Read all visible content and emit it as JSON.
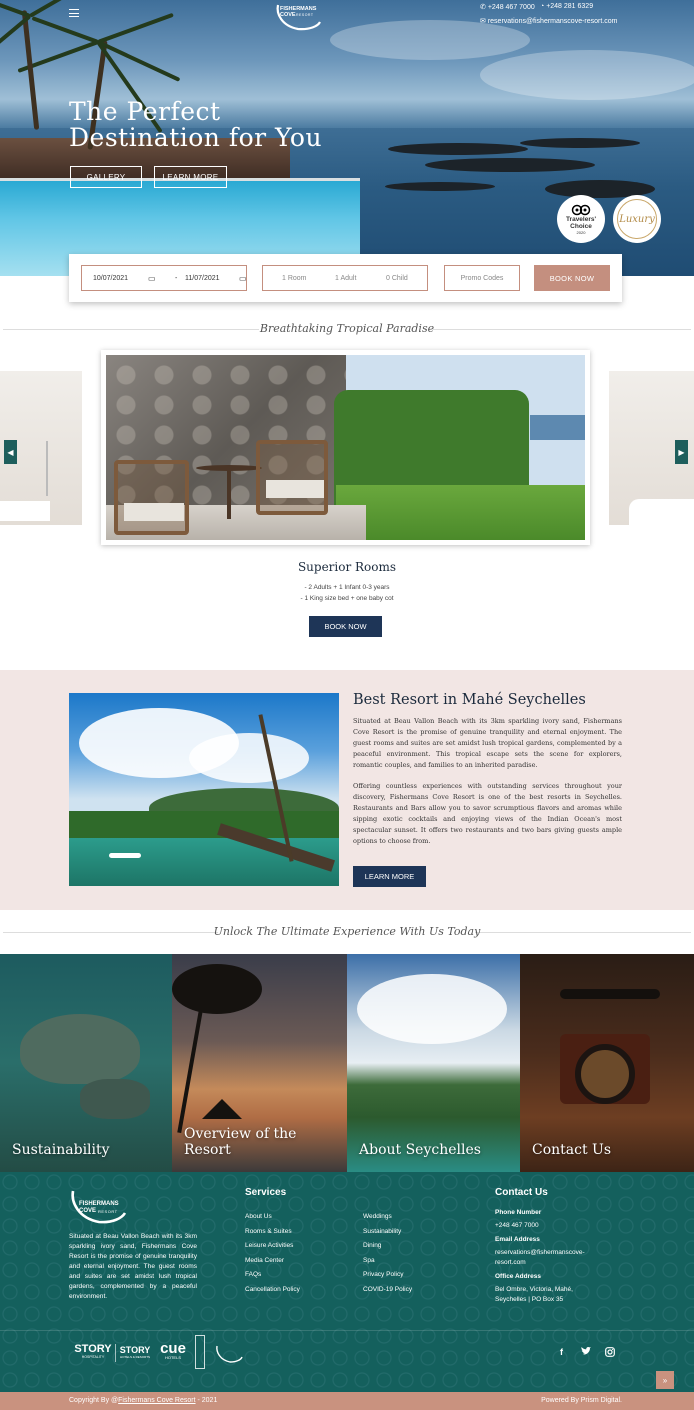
{
  "header": {
    "phone_1": "+248 467 7000",
    "phone_2": "+248 281 6329",
    "email": "reservations@fishermanscove-resort.com",
    "logo_line1": "FISHERMANS",
    "logo_line2": "COVE",
    "logo_line3": "RESORT"
  },
  "hero": {
    "title_line1": "The Perfect",
    "title_line2": "Destination for You",
    "gallery_label": "GALLERY",
    "learn_more_label": "LEARN MORE",
    "badge1_line1": "Travelers'",
    "badge1_line2": "Choice",
    "badge1_year": "2020",
    "badge2_text": "Luxury"
  },
  "booking": {
    "checkin": "10/07/2021",
    "separator": "-",
    "checkout": "11/07/2021",
    "rooms": "1 Room",
    "adults": "1 Adult",
    "children": "0 Child",
    "promo_placeholder": "Promo Codes",
    "book_label": "BOOK NOW"
  },
  "rooms_section": {
    "heading": "Breathtaking Tropical Paradise",
    "room_title": "Superior Rooms",
    "detail_1": "- 2 Adults + 1 Infant 0-3 years",
    "detail_2": "- 1 King size bed + one baby cot",
    "book_label": "BOOK NOW",
    "prev_arrow": "◀",
    "next_arrow": "▶"
  },
  "about": {
    "title": "Best Resort in Mahé Seychelles",
    "paragraph_1": "Situated at Beau Vallon Beach with its 3km sparkling ivory sand, Fishermans Cove Resort is the promise of genuine tranquility and eternal enjoyment. The guest rooms and suites are set amidst lush tropical gardens, complemented by a peaceful environment. This tropical escape sets the scene for explorers, romantic couples, and families to an inherited paradise.",
    "paragraph_2": "Offering countless experiences with outstanding services throughout your discovery, Fishermans Cove Resort is one of the best resorts in Seychelles. Restaurants and Bars allow you to savor scrumptious flavors and aromas while sipping exotic cocktails and enjoying views of the Indian Ocean's most spectacular sunset. It offers two restaurants and two bars giving guests ample options to choose from.",
    "button_label": "LEARN MORE"
  },
  "experience": {
    "heading": "Unlock The Ultimate Experience With Us Today",
    "tiles": [
      "Sustainability",
      "Overview of the Resort",
      "About Seychelles",
      "Contact Us"
    ]
  },
  "footer": {
    "logo_line1": "FISHERMANS",
    "logo_line2": "COVE",
    "logo_line3": "RESORT",
    "about_text": "Situated at Beau Vallon Beach with its 3km sparkling ivory sand, Fishermans Cove Resort is the promise of genuine tranquility and eternal enjoyment. The guest rooms and suites are set amidst lush tropical gardens, complemented by a peaceful environment.",
    "services_heading": "Services",
    "services_col1": [
      "About Us",
      "Rooms & Suites",
      "Leisure Activities",
      "Media Center",
      "FAQs",
      "Cancellation Policy"
    ],
    "services_col2": [
      "Weddings",
      "Sustainability",
      "Dining",
      "Spa",
      "Privacy Policy",
      "COVID-19 Policy"
    ],
    "contact_heading": "Contact Us",
    "phone_label": "Phone Number",
    "phone": "+248 467 7000",
    "email_label": "Email Address",
    "email_1": "reservations@fishermanscove-",
    "email_2": "resort.com",
    "office_label": "Office Address",
    "office_1": "Bel Ombre, Victoria, Mahé,",
    "office_2": "Seychelles | PO Box 35",
    "brand_1": "STORY",
    "brand_1_sub": "HOSPITALITY",
    "brand_2": "STORY",
    "brand_2_sub": "HOTELS & RESORTS",
    "brand_3": "cue",
    "brand_3_sub": "HOTELS",
    "social_facebook": "f",
    "copyright_prefix": "Copyright By @",
    "copyright_link": "Fishermans Cove Resort",
    "copyright_suffix": " - 2021",
    "powered_by": "Powered By Prism Digital.",
    "to_top": "»"
  }
}
